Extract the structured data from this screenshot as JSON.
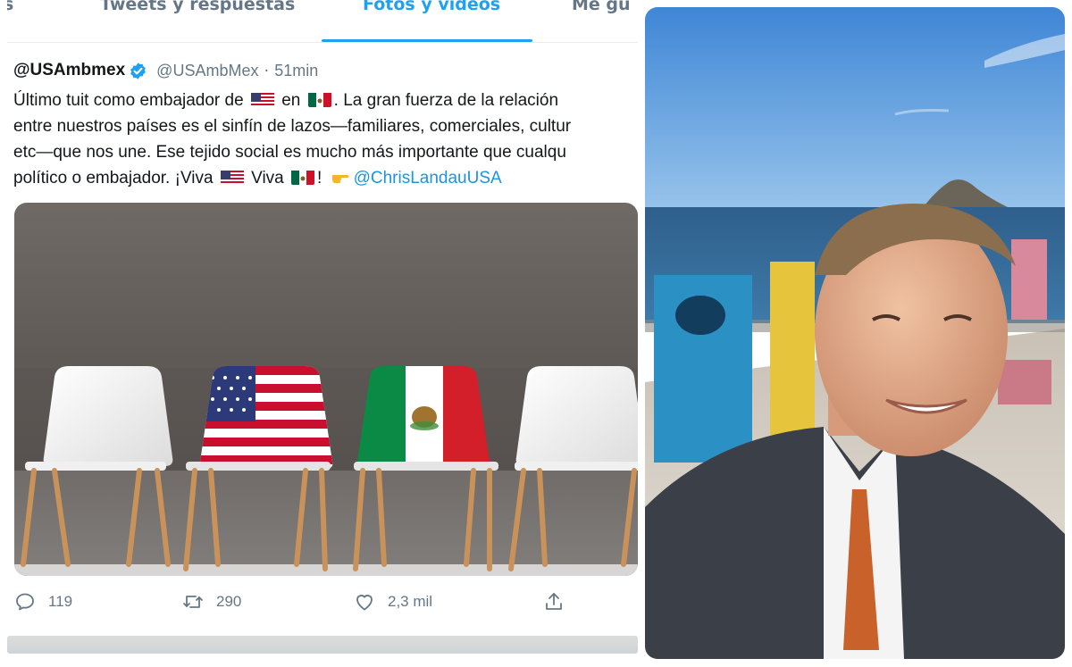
{
  "tabs": [
    {
      "label": "s"
    },
    {
      "label": "Tweets y respuestas"
    },
    {
      "label": "Fotos y videos"
    },
    {
      "label": "Me gu"
    }
  ],
  "tweet": {
    "display_name": "@USAmbmex",
    "handle": "@USAmbMex",
    "separator": "·",
    "time": "51min",
    "lines": [
      {
        "a": "Último tuit como embajador de",
        "b": "en",
        "c": ". La gran fuerza de la relación"
      },
      {
        "a": "entre nuestros países es el sinfín de lazos—familiares, comerciales, cultur"
      },
      {
        "a": "etc—que nos une. Ese tejido social es mucho más importante que cualqu"
      },
      {
        "a": "político o embajador. ¡Viva",
        "b": "Viva",
        "c": "!"
      }
    ],
    "mention": "@ChrisLandauUSA"
  },
  "actions": {
    "replies": "119",
    "retweets": "290",
    "likes": "2,3 mil"
  },
  "colors": {
    "accent": "#1da1f2",
    "mention": "#1b95e0",
    "muted": "#657786"
  },
  "icons": [
    "verified-badge-icon",
    "us-flag-icon",
    "mexico-flag-icon",
    "pointing-hand-icon",
    "reply-icon",
    "retweet-icon",
    "like-icon",
    "share-icon"
  ]
}
